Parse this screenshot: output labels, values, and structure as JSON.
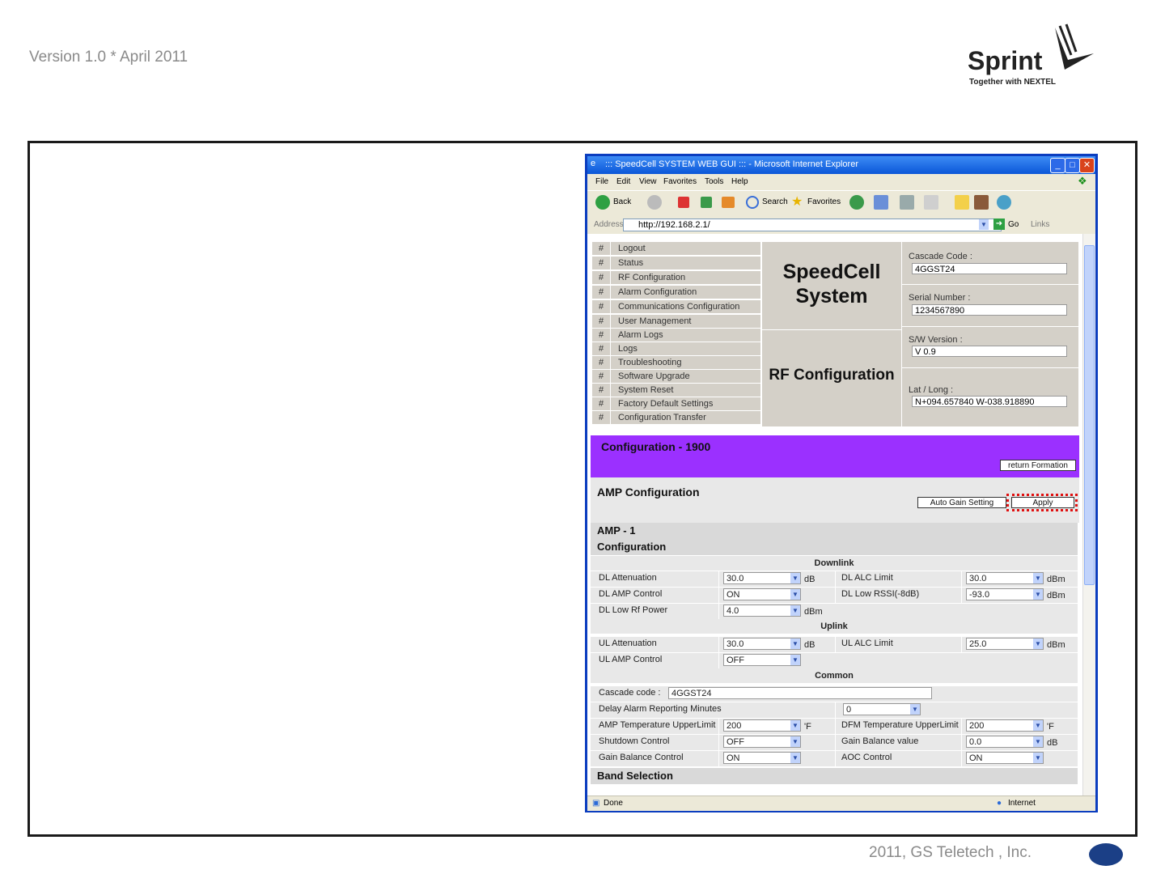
{
  "doc": {
    "version": "Version 1.0 * April 2011",
    "logo_name": "Sprint",
    "logo_tagline": "Together with NEXTEL",
    "footer": "2011, GS Teletech , Inc."
  },
  "window": {
    "title": "::: SpeedCell SYSTEM WEB GUI ::: - Microsoft Internet Explorer",
    "menu": [
      "File",
      "Edit",
      "View",
      "Favorites",
      "Tools",
      "Help"
    ],
    "toolbar": {
      "back": "Back",
      "search": "Search",
      "favorites": "Favorites"
    },
    "address_label": "Address",
    "address": "http://192.168.2.1/",
    "go": "Go",
    "links": "Links",
    "status": "Done",
    "zone": "Internet"
  },
  "nav": {
    "marker": "#",
    "items": [
      "Logout",
      "Status",
      "RF Configuration",
      "Alarm Configuration",
      "Communications Configuration",
      "User Management",
      "Alarm Logs",
      "Logs",
      "Troubleshooting",
      "Software Upgrade",
      "System Reset",
      "Factory Default Settings",
      "Configuration Transfer"
    ]
  },
  "brand": {
    "line1": "SpeedCell",
    "line2": "System",
    "section": "RF Configuration"
  },
  "info": {
    "cascade_label": "Cascade Code :",
    "cascade_value": "4GGST24",
    "serial_label": "Serial Number :",
    "serial_value": "1234567890",
    "sw_label": "S/W Version :",
    "sw_value": "V 0.9",
    "latlong_label": "Lat / Long :",
    "latlong_value": "N+094.657840 W-038.918890"
  },
  "config": {
    "title": "Configuration - 1900",
    "return_button": "return Formation"
  },
  "amp": {
    "title": "AMP Configuration",
    "auto_gain_button": "Auto Gain Setting",
    "apply_button": "Apply"
  },
  "amp1": {
    "title": "AMP - 1",
    "configuration": "Configuration",
    "downlink": "Downlink",
    "dl_atten_label": "DL Attenuation",
    "dl_atten_value": "30.0",
    "dl_atten_unit": "dB",
    "dl_alc_label": "DL ALC Limit",
    "dl_alc_value": "30.0",
    "dl_alc_unit": "dBm",
    "dl_amp_label": "DL AMP Control",
    "dl_amp_value": "ON",
    "dl_rssi_label": "DL Low RSSI(-8dB)",
    "dl_rssi_value": "-93.0",
    "dl_rssi_unit": "dBm",
    "dl_rf_label": "DL Low Rf Power",
    "dl_rf_value": "4.0",
    "dl_rf_unit": "dBm",
    "uplink": "Uplink",
    "ul_atten_label": "UL Attenuation",
    "ul_atten_value": "30.0",
    "ul_atten_unit": "dB",
    "ul_alc_label": "UL ALC Limit",
    "ul_alc_value": "25.0",
    "ul_alc_unit": "dBm",
    "ul_amp_label": "UL AMP Control",
    "ul_amp_value": "OFF",
    "common": "Common",
    "cascade_label": "Cascade code :",
    "cascade_value": "4GGST24",
    "delay_label": "Delay Alarm Reporting Minutes",
    "delay_value": "0",
    "amp_temp_label": "AMP Temperature UpperLimit",
    "amp_temp_value": "200",
    "amp_temp_unit": "'F",
    "dfm_temp_label": "DFM Temperature UpperLimit",
    "dfm_temp_value": "200",
    "dfm_temp_unit": "'F",
    "shutdown_label": "Shutdown Control",
    "shutdown_value": "OFF",
    "gain_bal_val_label": "Gain Balance value",
    "gain_bal_val_value": "0.0",
    "gain_bal_val_unit": "dB",
    "gain_bal_ctl_label": "Gain Balance Control",
    "gain_bal_ctl_value": "ON",
    "aoc_label": "AOC Control",
    "aoc_value": "ON",
    "band_selection": "Band Selection"
  },
  "colors": {
    "config_band": "#9b30ff",
    "highlight": "#e01010",
    "title_bar": "#0a56d8"
  }
}
